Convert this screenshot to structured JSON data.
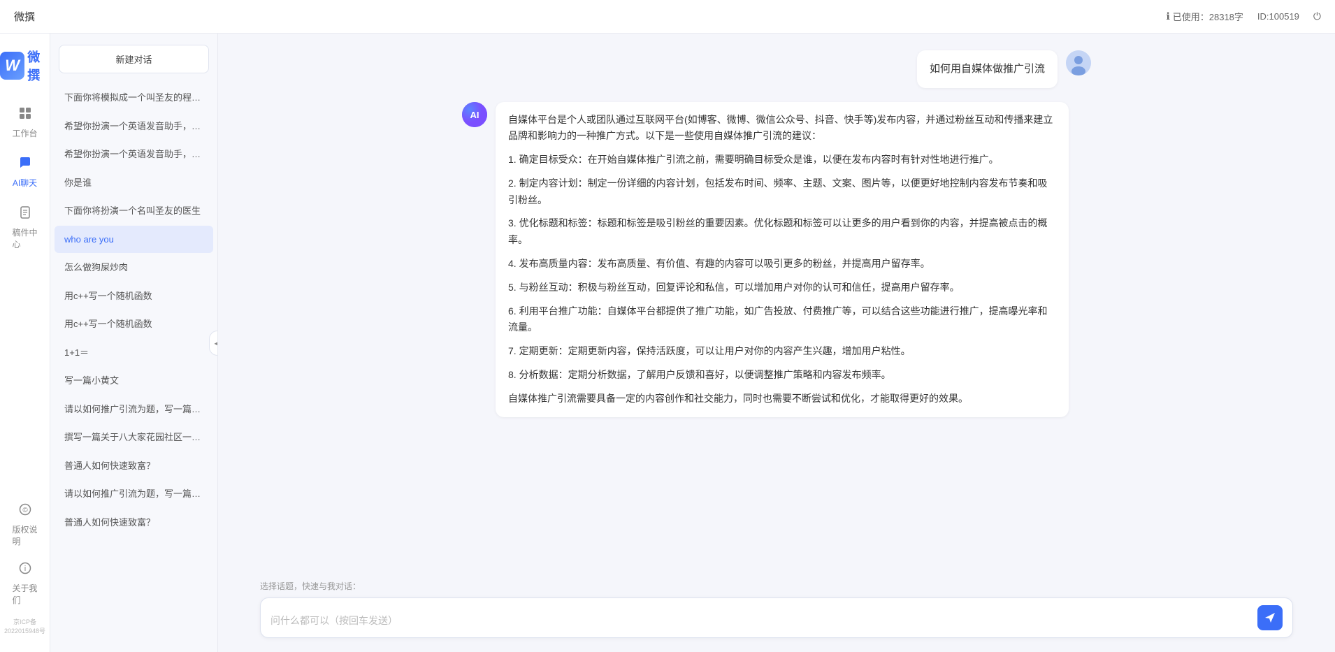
{
  "topbar": {
    "title": "微撰",
    "usage_label": "已使用：28318字",
    "id_label": "ID:100519",
    "usage_icon": "ℹ",
    "power_icon": "⏻"
  },
  "sidenav": {
    "logo_letter": "W",
    "logo_text": "微撰",
    "items": [
      {
        "id": "workbench",
        "label": "工作台",
        "icon": "⊞"
      },
      {
        "id": "ai-chat",
        "label": "AI聊天",
        "icon": "💬",
        "active": true
      },
      {
        "id": "draft",
        "label": "稿件中心",
        "icon": "📄"
      }
    ],
    "bottom_items": [
      {
        "id": "copyright",
        "label": "版权说明",
        "icon": "©"
      },
      {
        "id": "about",
        "label": "关于我们",
        "icon": "ℹ"
      }
    ],
    "icp": "京ICP备2022015948号"
  },
  "conv_panel": {
    "new_btn_label": "新建对话",
    "collapse_icon": "◀",
    "items": [
      {
        "id": 1,
        "text": "下面你将模拟成一个叫圣友的程序员、我说...",
        "active": false
      },
      {
        "id": 2,
        "text": "希望你扮演一个英语发音助手，我提供给你...",
        "active": false
      },
      {
        "id": 3,
        "text": "希望你扮演一个英语发音助手，我提供给你...",
        "active": false
      },
      {
        "id": 4,
        "text": "你是谁",
        "active": false
      },
      {
        "id": 5,
        "text": "下面你将扮演一个名叫圣友的医生",
        "active": false
      },
      {
        "id": 6,
        "text": "who are you",
        "active": true
      },
      {
        "id": 7,
        "text": "怎么做狗屎炒肉",
        "active": false
      },
      {
        "id": 8,
        "text": "用c++写一个随机函数",
        "active": false
      },
      {
        "id": 9,
        "text": "用c++写一个随机函数",
        "active": false
      },
      {
        "id": 10,
        "text": "1+1＝",
        "active": false
      },
      {
        "id": 11,
        "text": "写一篇小黄文",
        "active": false
      },
      {
        "id": 12,
        "text": "请以如何推广引流为题，写一篇大纲",
        "active": false
      },
      {
        "id": 13,
        "text": "撰写一篇关于八大家花园社区一刻钟便民生...",
        "active": false
      },
      {
        "id": 14,
        "text": "普通人如何快速致富？",
        "active": false
      },
      {
        "id": 15,
        "text": "请以如何推广引流为题，写一篇大纲",
        "active": false
      },
      {
        "id": 16,
        "text": "普通人如何快速致富？",
        "active": false
      }
    ]
  },
  "chat": {
    "messages": [
      {
        "id": 1,
        "role": "user",
        "avatar_type": "user",
        "text": "如何用自媒体做推广引流"
      },
      {
        "id": 2,
        "role": "ai",
        "avatar_type": "ai",
        "avatar_label": "AI",
        "paragraphs": [
          "自媒体平台是个人或团队通过互联网平台(如博客、微博、微信公众号、抖音、快手等)发布内容，并通过粉丝互动和传播来建立品牌和影响力的一种推广方式。以下是一些使用自媒体推广引流的建议：",
          "1. 确定目标受众：在开始自媒体推广引流之前，需要明确目标受众是谁，以便在发布内容时有针对性地进行推广。",
          "2. 制定内容计划：制定一份详细的内容计划，包括发布时间、频率、主题、文案、图片等，以便更好地控制内容发布节奏和吸引粉丝。",
          "3. 优化标题和标签：标题和标签是吸引粉丝的重要因素。优化标题和标签可以让更多的用户看到你的内容，并提高被点击的概率。",
          "4. 发布高质量内容：发布高质量、有价值、有趣的内容可以吸引更多的粉丝，并提高用户留存率。",
          "5. 与粉丝互动：积极与粉丝互动，回复评论和私信，可以增加用户对你的认可和信任，提高用户留存率。",
          "6. 利用平台推广功能：自媒体平台都提供了推广功能，如广告投放、付费推广等，可以结合这些功能进行推广，提高曝光率和流量。",
          "7. 定期更新：定期更新内容，保持活跃度，可以让用户对你的内容产生兴趣，增加用户粘性。",
          "8. 分析数据：定期分析数据，了解用户反馈和喜好，以便调整推广策略和内容发布频率。",
          "自媒体推广引流需要具备一定的内容创作和社交能力，同时也需要不断尝试和优化，才能取得更好的效果。"
        ]
      }
    ],
    "quick_topics_label": "选择话题，快速与我对话：",
    "input_placeholder": "问什么都可以（按回车发送）",
    "send_icon": "➤"
  }
}
